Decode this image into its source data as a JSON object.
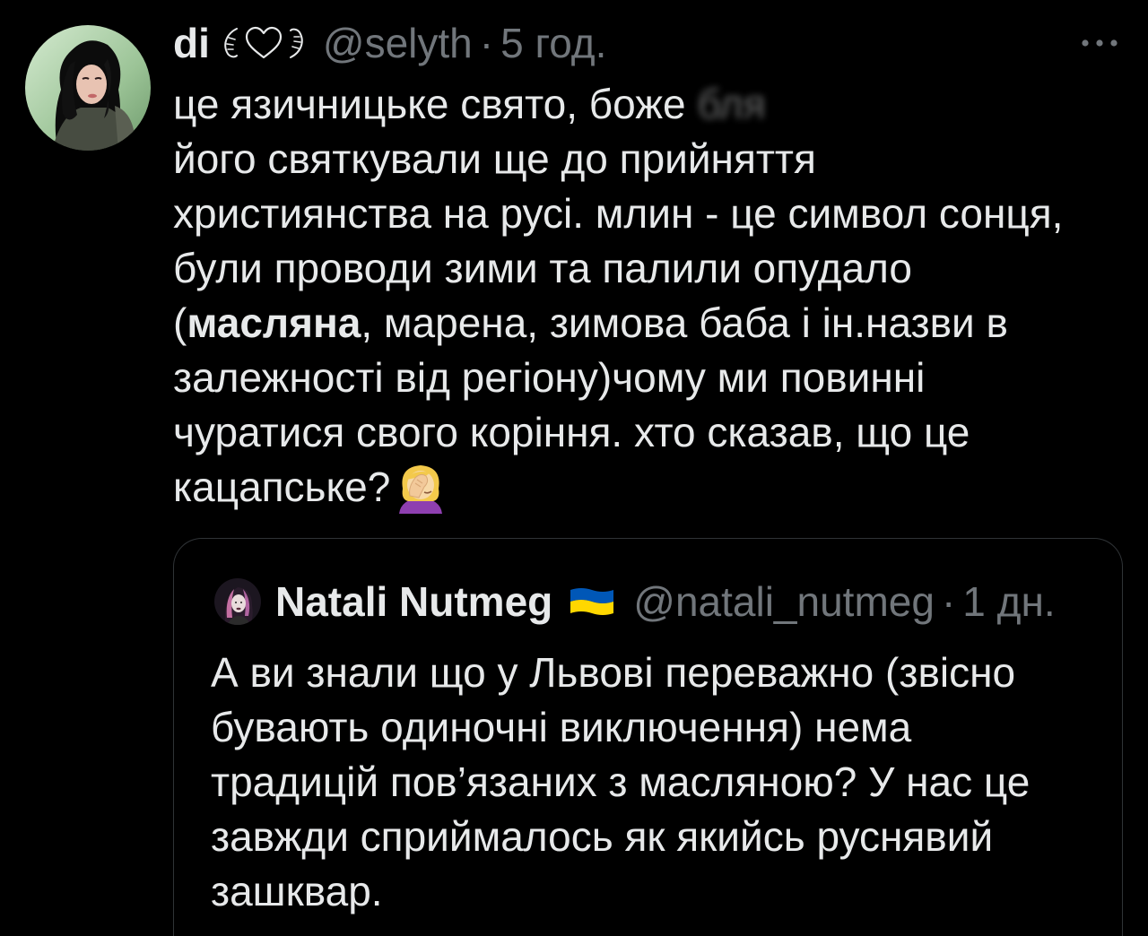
{
  "colors": {
    "background": "#000000",
    "text": "#e7e9ea",
    "secondary_text": "#71767b",
    "border": "#2f3336",
    "flag_blue": "#0057b7",
    "flag_yellow": "#ffd700"
  },
  "tweet": {
    "author": {
      "name": "di",
      "name_decoration": "wings-heart-icon",
      "handle": "@selyth",
      "separator": "·",
      "timestamp": "5 год."
    },
    "more_icon": "more-horizontal-icon",
    "text": {
      "line1": "це язичницьке свято, боже",
      "line1_censored": "бля",
      "line2": "його святкували ще до прийняття",
      "line3": "християнства на русі. млин - це символ сонця,",
      "line4": "були проводи зими та палили опудало",
      "line5_paren": "(",
      "line5_bold": "масляна",
      "line5_rest": ", марена, зимова баба і ін.назви в",
      "line6": "залежності від регіону)чому ми повинні",
      "line7": "чуратися свого коріння. хто сказав, що це",
      "line8": "кацапське?",
      "line8_emoji": "woman-facepalming-emoji"
    }
  },
  "quoted_tweet": {
    "author": {
      "name": "Natali Nutmeg",
      "flag_emoji": "ukraine-flag-emoji",
      "handle": "@natali_nutmeg",
      "separator": "·",
      "timestamp": "1 дн."
    },
    "lines": [
      "А ви знали що у Львові переважно (звісно",
      "бувають одиночні виключення) нема",
      "традицій пов’язаних з масляною? У нас це",
      "завжди сприймалось як якийсь руснявий",
      "зашквар."
    ]
  }
}
